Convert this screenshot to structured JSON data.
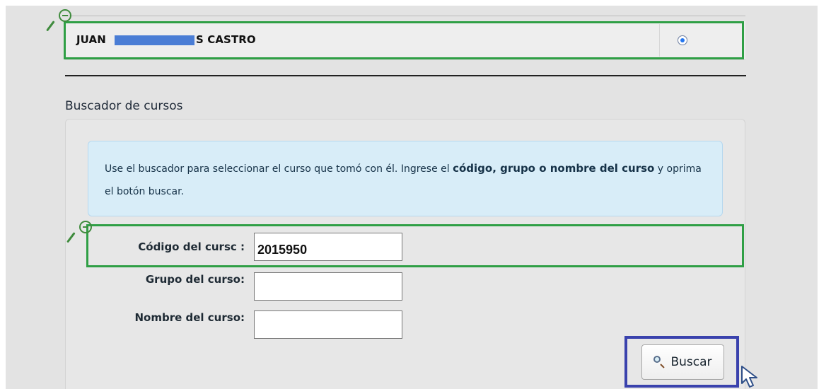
{
  "student": {
    "name_left": "JUAN",
    "name_right": "S CASTRO",
    "selected": true
  },
  "section": {
    "title": "Buscador de cursos"
  },
  "info": {
    "prefix": "Use el buscador para seleccionar el curso que tomó con él. Ingrese el ",
    "emphasis": "código, grupo o nombre del curso",
    "suffix": " y oprima el botón buscar."
  },
  "form": {
    "codigo_label": "Código del cursc :",
    "codigo_value": "2015950",
    "grupo_label": "Grupo del curso:",
    "grupo_value": "",
    "nombre_label": "Nombre del curso:",
    "nombre_value": ""
  },
  "action": {
    "buscar_label": "Buscar"
  },
  "colors": {
    "highlight_green": "#2f9f45",
    "highlight_blue": "#3a42ad",
    "radio_blue": "#2476ef",
    "redaction_blue": "#4a7dd5"
  },
  "icons": {
    "magnifier": "magnifier-icon",
    "search": "search-icon",
    "cursor": "cursor-icon"
  }
}
